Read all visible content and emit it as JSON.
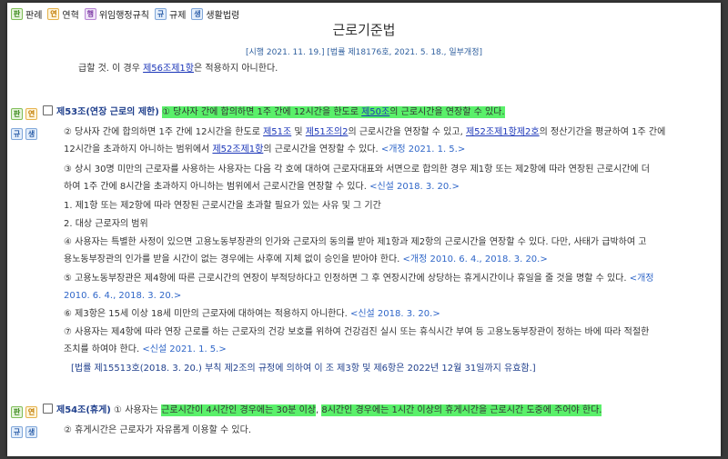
{
  "legend": [
    {
      "badge": "판",
      "label": "판례",
      "style": "b-pan"
    },
    {
      "badge": "연",
      "label": "연혁",
      "style": "b-yeon"
    },
    {
      "badge": "행",
      "label": "위임행정규칙",
      "style": "b-wi"
    },
    {
      "badge": "규",
      "label": "규제",
      "style": "b-gyu"
    },
    {
      "badge": "생",
      "label": "생활법령",
      "style": "b-saeng"
    }
  ],
  "title": "근로기준법",
  "subtitle": "[시행 2021. 11. 19.] [법률 제18176호, 2021. 5. 18., 일부개정]",
  "prev_line": {
    "pre": "급할 것. 이 경우 ",
    "link": "제56조제1항",
    "post": "은 적용하지 아니한다."
  },
  "art53": {
    "title": "제53조(연장 근로의 제한)",
    "p1_pre": "① 당사자 간에 합의하면 1주 간에 12시간을 한도로 ",
    "p1_link": "제50조",
    "p1_post": "의 근로시간을 연장할 수 있다.",
    "p2a_pre": "② 당사자 간에 합의하면 1주 간에 12시간을 한도로 ",
    "p2a_link1": "제51조",
    "p2a_mid1": " 및 ",
    "p2a_link2": "제51조의2",
    "p2a_mid2": "의 근로시간을 연장할 수 있고, ",
    "p2a_link3": "제52조제1항제2호",
    "p2a_post": "의 정산기간을 평균하여 1주 간에",
    "p2b_pre": "12시간을 초과하지 아니하는 범위에서 ",
    "p2b_link": "제52조제1항",
    "p2b_post": "의 근로시간을 연장할 수 있다. ",
    "p2b_amend": "<개정 2021. 1. 5.>",
    "p3a": "③ 상시 30명 미만의 근로자를 사용하는 사용자는 다음 각 호에 대하여 근로자대표와 서면으로 합의한 경우 제1항 또는 제2항에 따라 연장된 근로시간에 더",
    "p3b": "하여 1주 간에 8시간을 초과하지 아니하는 범위에서 근로시간을 연장할 수 있다. ",
    "p3b_amend": "<신설 2018. 3. 20.>",
    "item1": "1. 제1항 또는 제2항에 따라 연장된 근로시간을 초과할 필요가 있는 사유 및 그 기간",
    "item2": "2. 대상 근로자의 범위",
    "p4a": "④ 사용자는 특별한 사정이 있으면 고용노동부장관의 인가와 근로자의 동의를 받아 제1항과 제2항의 근로시간을 연장할 수 있다. 다만, 사태가 급박하여 고",
    "p4b": "용노동부장관의 인가를 받을 시간이 없는 경우에는 사후에 지체 없이 승인을 받아야 한다. ",
    "p4b_amend": "<개정 2010. 6. 4., 2018. 3. 20.>",
    "p5a": "⑤ 고용노동부장관은 제4항에 따른 근로시간의 연장이 부적당하다고 인정하면 그 후 연장시간에 상당하는 휴게시간이나 휴일을 줄 것을 명할 수 있다. ",
    "p5a_amend": "<개정",
    "p5b_amend": "2010. 6. 4., 2018. 3. 20.>",
    "p6": "⑥ 제3항은 15세 이상 18세 미만의 근로자에 대하여는 적용하지 아니한다. ",
    "p6_amend": "<신설 2018. 3. 20.>",
    "p7a": "⑦ 사용자는 제4항에 따라 연장 근로를 하는 근로자의 건강 보호를 위하여 건강검진 실시 또는 휴식시간 부여 등 고용노동부장관이 정하는 바에 따라 적절한",
    "p7b": "조치를 하여야 한다. ",
    "p7b_amend": "<신설 2021. 1. 5.>",
    "note": "[법률 제15513호(2018. 3. 20.) 부칙 제2조의 규정에 의하여 이 조 제3항 및 제6항은 2022년 12월 31일까지 유효함.]"
  },
  "art54": {
    "title": "제54조(휴게)",
    "p1_pre": "① 사용자는 ",
    "p1_hl1": "근로시간이 4시간인 경우에는 30분 이상",
    "p1_mid": ", ",
    "p1_hl2": "8시간인 경우에는 1시간 이상의 휴게시간을 근로시간 도중에 주어야 한다.",
    "p2": "② 휴게시간은 근로자가 자유롭게 이용할 수 있다."
  },
  "colors": {
    "highlight": "#5af06a",
    "link": "#1a35b8",
    "amend": "#2f66c8"
  }
}
